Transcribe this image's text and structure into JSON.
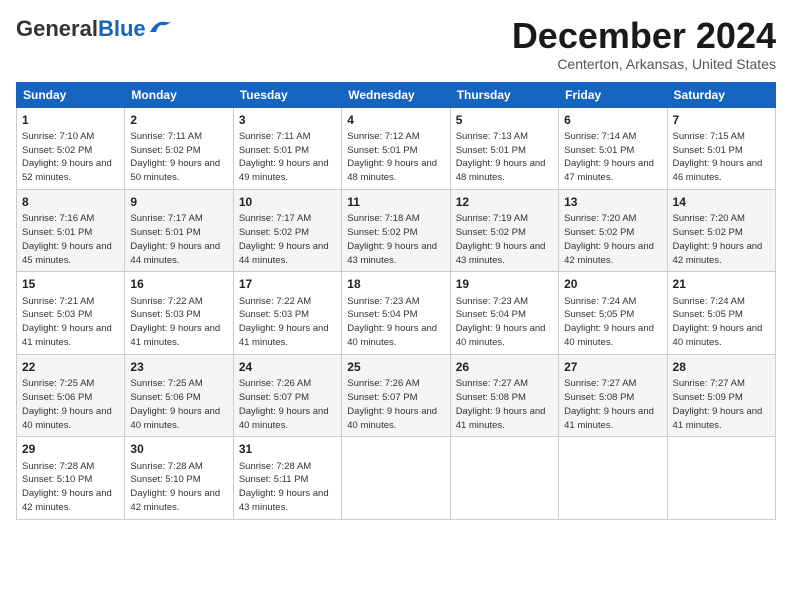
{
  "header": {
    "logo_general": "General",
    "logo_blue": "Blue",
    "month_title": "December 2024",
    "location": "Centerton, Arkansas, United States"
  },
  "days_of_week": [
    "Sunday",
    "Monday",
    "Tuesday",
    "Wednesday",
    "Thursday",
    "Friday",
    "Saturday"
  ],
  "weeks": [
    [
      {
        "day": 1,
        "sunrise": "7:10 AM",
        "sunset": "5:02 PM",
        "daylight": "9 hours and 52 minutes."
      },
      {
        "day": 2,
        "sunrise": "7:11 AM",
        "sunset": "5:02 PM",
        "daylight": "9 hours and 50 minutes."
      },
      {
        "day": 3,
        "sunrise": "7:11 AM",
        "sunset": "5:01 PM",
        "daylight": "9 hours and 49 minutes."
      },
      {
        "day": 4,
        "sunrise": "7:12 AM",
        "sunset": "5:01 PM",
        "daylight": "9 hours and 48 minutes."
      },
      {
        "day": 5,
        "sunrise": "7:13 AM",
        "sunset": "5:01 PM",
        "daylight": "9 hours and 48 minutes."
      },
      {
        "day": 6,
        "sunrise": "7:14 AM",
        "sunset": "5:01 PM",
        "daylight": "9 hours and 47 minutes."
      },
      {
        "day": 7,
        "sunrise": "7:15 AM",
        "sunset": "5:01 PM",
        "daylight": "9 hours and 46 minutes."
      }
    ],
    [
      {
        "day": 8,
        "sunrise": "7:16 AM",
        "sunset": "5:01 PM",
        "daylight": "9 hours and 45 minutes."
      },
      {
        "day": 9,
        "sunrise": "7:17 AM",
        "sunset": "5:01 PM",
        "daylight": "9 hours and 44 minutes."
      },
      {
        "day": 10,
        "sunrise": "7:17 AM",
        "sunset": "5:02 PM",
        "daylight": "9 hours and 44 minutes."
      },
      {
        "day": 11,
        "sunrise": "7:18 AM",
        "sunset": "5:02 PM",
        "daylight": "9 hours and 43 minutes."
      },
      {
        "day": 12,
        "sunrise": "7:19 AM",
        "sunset": "5:02 PM",
        "daylight": "9 hours and 43 minutes."
      },
      {
        "day": 13,
        "sunrise": "7:20 AM",
        "sunset": "5:02 PM",
        "daylight": "9 hours and 42 minutes."
      },
      {
        "day": 14,
        "sunrise": "7:20 AM",
        "sunset": "5:02 PM",
        "daylight": "9 hours and 42 minutes."
      }
    ],
    [
      {
        "day": 15,
        "sunrise": "7:21 AM",
        "sunset": "5:03 PM",
        "daylight": "9 hours and 41 minutes."
      },
      {
        "day": 16,
        "sunrise": "7:22 AM",
        "sunset": "5:03 PM",
        "daylight": "9 hours and 41 minutes."
      },
      {
        "day": 17,
        "sunrise": "7:22 AM",
        "sunset": "5:03 PM",
        "daylight": "9 hours and 41 minutes."
      },
      {
        "day": 18,
        "sunrise": "7:23 AM",
        "sunset": "5:04 PM",
        "daylight": "9 hours and 40 minutes."
      },
      {
        "day": 19,
        "sunrise": "7:23 AM",
        "sunset": "5:04 PM",
        "daylight": "9 hours and 40 minutes."
      },
      {
        "day": 20,
        "sunrise": "7:24 AM",
        "sunset": "5:05 PM",
        "daylight": "9 hours and 40 minutes."
      },
      {
        "day": 21,
        "sunrise": "7:24 AM",
        "sunset": "5:05 PM",
        "daylight": "9 hours and 40 minutes."
      }
    ],
    [
      {
        "day": 22,
        "sunrise": "7:25 AM",
        "sunset": "5:06 PM",
        "daylight": "9 hours and 40 minutes."
      },
      {
        "day": 23,
        "sunrise": "7:25 AM",
        "sunset": "5:06 PM",
        "daylight": "9 hours and 40 minutes."
      },
      {
        "day": 24,
        "sunrise": "7:26 AM",
        "sunset": "5:07 PM",
        "daylight": "9 hours and 40 minutes."
      },
      {
        "day": 25,
        "sunrise": "7:26 AM",
        "sunset": "5:07 PM",
        "daylight": "9 hours and 40 minutes."
      },
      {
        "day": 26,
        "sunrise": "7:27 AM",
        "sunset": "5:08 PM",
        "daylight": "9 hours and 41 minutes."
      },
      {
        "day": 27,
        "sunrise": "7:27 AM",
        "sunset": "5:08 PM",
        "daylight": "9 hours and 41 minutes."
      },
      {
        "day": 28,
        "sunrise": "7:27 AM",
        "sunset": "5:09 PM",
        "daylight": "9 hours and 41 minutes."
      }
    ],
    [
      {
        "day": 29,
        "sunrise": "7:28 AM",
        "sunset": "5:10 PM",
        "daylight": "9 hours and 42 minutes."
      },
      {
        "day": 30,
        "sunrise": "7:28 AM",
        "sunset": "5:10 PM",
        "daylight": "9 hours and 42 minutes."
      },
      {
        "day": 31,
        "sunrise": "7:28 AM",
        "sunset": "5:11 PM",
        "daylight": "9 hours and 43 minutes."
      },
      null,
      null,
      null,
      null
    ]
  ]
}
